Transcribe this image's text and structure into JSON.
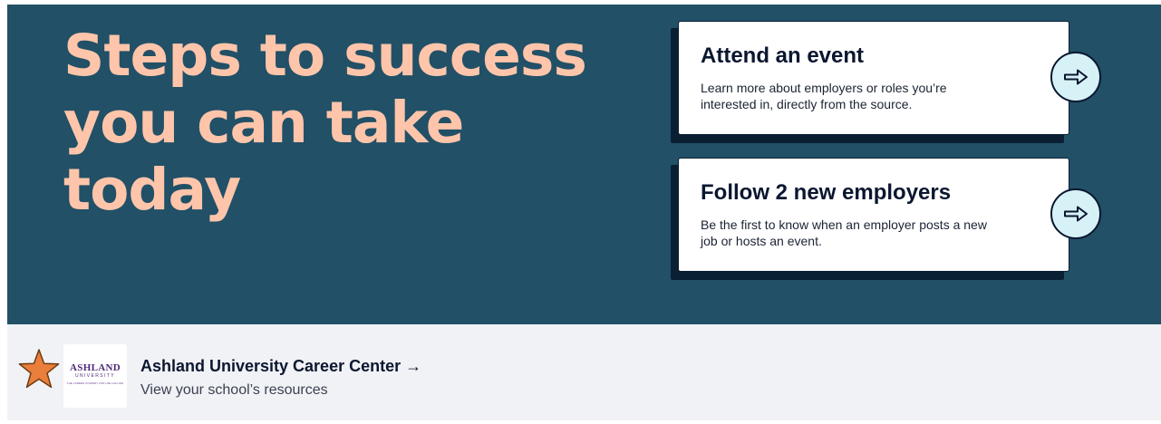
{
  "hero": {
    "headline": "Steps to success you can take today",
    "background_color": "#215067",
    "headline_color": "#ffc5aa",
    "cards": [
      {
        "title": "Attend an event",
        "description": "Learn more about employers or roles you’re interested in, directly from the source.",
        "action_icon": "arrow-right-icon"
      },
      {
        "title": "Follow 2 new employers",
        "description": "Be the first to know when an employer posts a new job or hosts an event.",
        "action_icon": "arrow-right-icon"
      }
    ]
  },
  "school": {
    "name": "Ashland University Career Center →",
    "subtitle": "View your school’s resources",
    "logo": {
      "name": "ASHLAND",
      "sub": "UNIVERSITY",
      "tagline": "THE CAREER JOURNEY FOR LIFE CALLING"
    },
    "badge_icon": "star-icon",
    "badge_color": "#e97f3b"
  }
}
